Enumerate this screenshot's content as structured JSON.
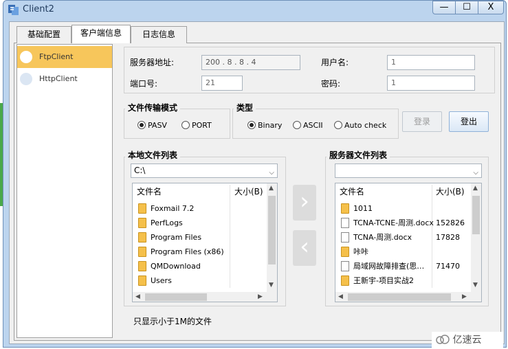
{
  "window": {
    "title": "Client2",
    "minimize": "—",
    "maximize": "☐",
    "close": "X"
  },
  "tabs": [
    {
      "label": "基础配置"
    },
    {
      "label": "客户端信息"
    },
    {
      "label": "日志信息"
    }
  ],
  "connections": [
    {
      "label": "FtpClient"
    },
    {
      "label": "HttpClient"
    }
  ],
  "server": {
    "address_label": "服务器地址:",
    "address_value": "200 .  8  .  8  .  4",
    "user_label": "用户名:",
    "user_value": "1",
    "port_label": "端口号:",
    "port_value": "21",
    "password_label": "密码:",
    "password_value": "1"
  },
  "transfer_mode": {
    "title": "文件传输模式",
    "options": [
      "PASV",
      "PORT"
    ],
    "selected": "PASV"
  },
  "type": {
    "title": "类型",
    "options": [
      "Binary",
      "ASCII",
      "Auto check"
    ],
    "selected": "Binary"
  },
  "buttons": {
    "login": "登录",
    "logout": "登出"
  },
  "local": {
    "title": "本地文件列表",
    "path": "C:\\",
    "col_name": "文件名",
    "col_size": "大小(B)",
    "files": [
      {
        "name": "Foxmail 7.2",
        "size": ""
      },
      {
        "name": "PerfLogs",
        "size": ""
      },
      {
        "name": "Program Files",
        "size": ""
      },
      {
        "name": "Program Files (x86)",
        "size": ""
      },
      {
        "name": "QMDownload",
        "size": ""
      },
      {
        "name": "Users",
        "size": ""
      }
    ]
  },
  "remote": {
    "title": "服务器文件列表",
    "path": "",
    "col_name": "文件名",
    "col_size": "大小(B)",
    "files": [
      {
        "name": "1011",
        "size": ""
      },
      {
        "name": "TCNA-TCNE-周测.docx",
        "size": "152826"
      },
      {
        "name": "TCNA-周测.docx",
        "size": "17828"
      },
      {
        "name": "咔咔",
        "size": ""
      },
      {
        "name": "局域网故障排查(思…",
        "size": "71470"
      },
      {
        "name": "王新宇-项目实战2",
        "size": ""
      }
    ]
  },
  "footer_note": "只显示小于1M的文件",
  "watermark": "亿速云"
}
